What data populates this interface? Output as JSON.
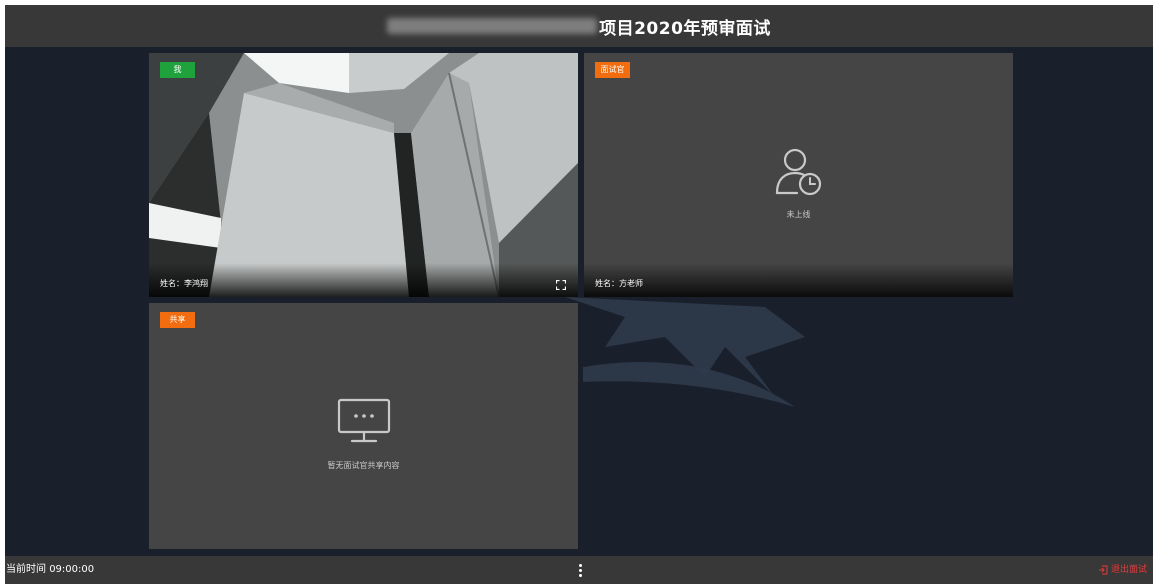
{
  "header": {
    "title": "项目2020年预审面试"
  },
  "tiles": {
    "me": {
      "badge": "我",
      "name_prefix": "姓名：",
      "name": "李鸿翔"
    },
    "examiner": {
      "badge": "面试官",
      "status": "未上线",
      "name_prefix": "姓名：",
      "name": "方老师"
    },
    "share": {
      "badge": "共享",
      "empty_text": "暂无面试官共享内容"
    }
  },
  "footer": {
    "clock_label": "当前时间",
    "clock_value": "09:00:00",
    "exit_label": "退出面试"
  },
  "colors": {
    "background": "#19202b",
    "bar": "#383838",
    "tile": "#454545",
    "badge_me": "#1fa23c",
    "badge_other": "#f26d0f",
    "exit": "#e23c3c"
  },
  "icons": {
    "examiner_status": "user-clock-icon",
    "share_empty": "monitor-icon",
    "fullscreen": "fullscreen-icon",
    "more": "more-vertical-icon",
    "exit": "exit-icon"
  }
}
